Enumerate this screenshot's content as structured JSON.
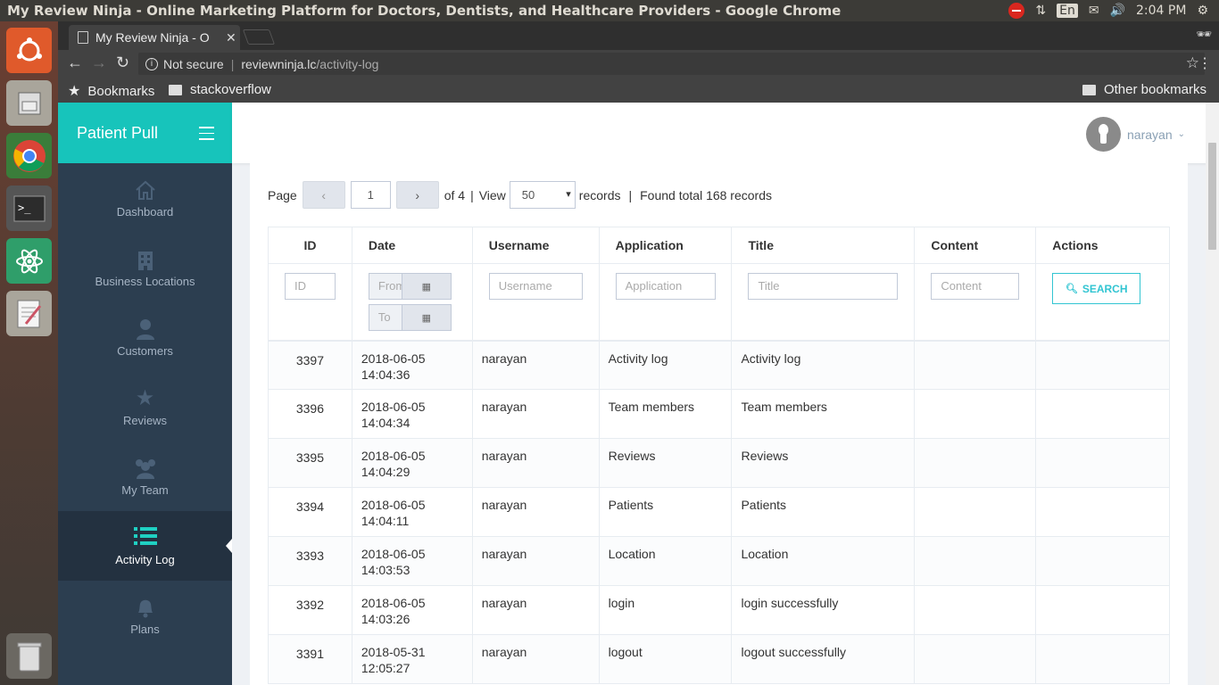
{
  "os": {
    "window_title": "My Review Ninja - Online Marketing Platform for Doctors, Dentists, and Healthcare Providers - Google Chrome",
    "keyboard_layout": "En",
    "clock": "2:04 PM"
  },
  "browser": {
    "tab_title": "My Review Ninja - O",
    "security_label": "Not secure",
    "url_host": "reviewninja.lc",
    "url_path": "/activity-log",
    "bookmarks": [
      "Bookmarks",
      "stackoverflow"
    ],
    "other_bookmarks": "Other bookmarks"
  },
  "app": {
    "brand": "Patient Pull",
    "user": "narayan",
    "nav": [
      {
        "label": "Dashboard",
        "icon": "home-icon"
      },
      {
        "label": "Business Locations",
        "icon": "building-icon"
      },
      {
        "label": "Customers",
        "icon": "user-icon"
      },
      {
        "label": "Reviews",
        "icon": "star-icon"
      },
      {
        "label": "My Team",
        "icon": "users-icon"
      },
      {
        "label": "Activity Log",
        "icon": "list-icon",
        "active": true
      },
      {
        "label": "Plans",
        "icon": "bell-icon"
      }
    ]
  },
  "pager": {
    "page_label": "Page",
    "prev": "‹",
    "next": "›",
    "current": "1",
    "of_label": "of 4",
    "view_label": "View",
    "per_page": "50",
    "records_label": "records",
    "found_label": "Found total 168 records"
  },
  "table": {
    "headers": [
      "ID",
      "Date",
      "Username",
      "Application",
      "Title",
      "Content",
      "Actions"
    ],
    "filters": {
      "id": "ID",
      "from": "From",
      "to": "To",
      "username": "Username",
      "application": "Application",
      "title": "Title",
      "content": "Content",
      "search": "SEARCH"
    },
    "rows": [
      {
        "id": "3397",
        "date": "2018-06-05",
        "time": "14:04:36",
        "user": "narayan",
        "app": "Activity log",
        "title": "Activity log"
      },
      {
        "id": "3396",
        "date": "2018-06-05",
        "time": "14:04:34",
        "user": "narayan",
        "app": "Team members",
        "title": "Team members"
      },
      {
        "id": "3395",
        "date": "2018-06-05",
        "time": "14:04:29",
        "user": "narayan",
        "app": "Reviews",
        "title": "Reviews"
      },
      {
        "id": "3394",
        "date": "2018-06-05",
        "time": "14:04:11",
        "user": "narayan",
        "app": "Patients",
        "title": "Patients"
      },
      {
        "id": "3393",
        "date": "2018-06-05",
        "time": "14:03:53",
        "user": "narayan",
        "app": "Location",
        "title": "Location"
      },
      {
        "id": "3392",
        "date": "2018-06-05",
        "time": "14:03:26",
        "user": "narayan",
        "app": "login",
        "title": "login successfully"
      },
      {
        "id": "3391",
        "date": "2018-05-31",
        "time": "12:05:27",
        "user": "narayan",
        "app": "logout",
        "title": "logout successfully"
      }
    ]
  }
}
